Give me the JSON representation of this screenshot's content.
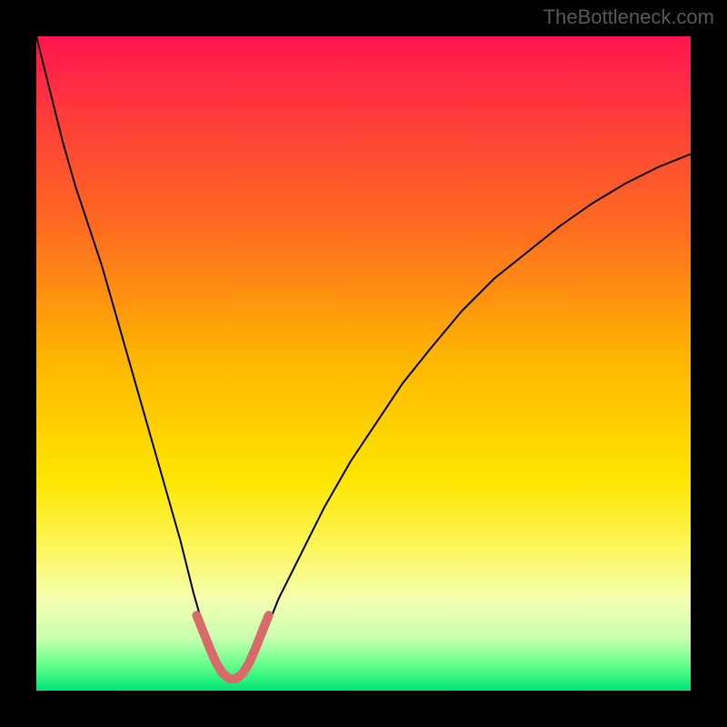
{
  "watermark": "TheBottleneck.com",
  "chart_data": {
    "type": "line",
    "title": "",
    "xlabel": "",
    "ylabel": "",
    "xlim": [
      0,
      100
    ],
    "ylim": [
      0,
      100
    ],
    "background_gradient": {
      "stops": [
        {
          "offset": 0.0,
          "color": "#ff1450"
        },
        {
          "offset": 0.12,
          "color": "#ff3b3b"
        },
        {
          "offset": 0.3,
          "color": "#ff6e1f"
        },
        {
          "offset": 0.5,
          "color": "#ffb800"
        },
        {
          "offset": 0.68,
          "color": "#ffe600"
        },
        {
          "offset": 0.78,
          "color": "#fdf65a"
        },
        {
          "offset": 0.86,
          "color": "#f5ffb0"
        },
        {
          "offset": 0.92,
          "color": "#c8ffb0"
        },
        {
          "offset": 0.96,
          "color": "#66ff8a"
        },
        {
          "offset": 1.0,
          "color": "#00e676"
        }
      ]
    },
    "series": [
      {
        "name": "bottleneck-curve",
        "color": "#000000",
        "width": 2,
        "x": [
          0,
          2,
          4,
          6,
          8,
          10,
          12,
          14,
          16,
          18,
          20,
          22,
          24,
          26,
          28,
          29,
          30,
          31,
          33,
          35,
          37,
          40,
          44,
          48,
          52,
          56,
          60,
          65,
          70,
          75,
          80,
          85,
          90,
          95,
          100
        ],
        "y": [
          100,
          92,
          84,
          77,
          71,
          65,
          58,
          51,
          44,
          37,
          30,
          23,
          15,
          8,
          4,
          2,
          1.5,
          2,
          5,
          9,
          14,
          20,
          28,
          35,
          41,
          47,
          52,
          58,
          63,
          67,
          71,
          74.5,
          77.5,
          80,
          82
        ]
      },
      {
        "name": "trough-marker",
        "color": "#d96a6a",
        "width": 10,
        "linecap": "round",
        "x": [
          24.5,
          25.5,
          26.5,
          27.5,
          28.5,
          29.5,
          30.5,
          31.5,
          32.5,
          33.5,
          34.5,
          35.5
        ],
        "y": [
          11.5,
          9.0,
          6.5,
          4.2,
          2.6,
          1.8,
          1.8,
          2.6,
          4.2,
          6.5,
          9.0,
          11.5
        ]
      }
    ]
  }
}
